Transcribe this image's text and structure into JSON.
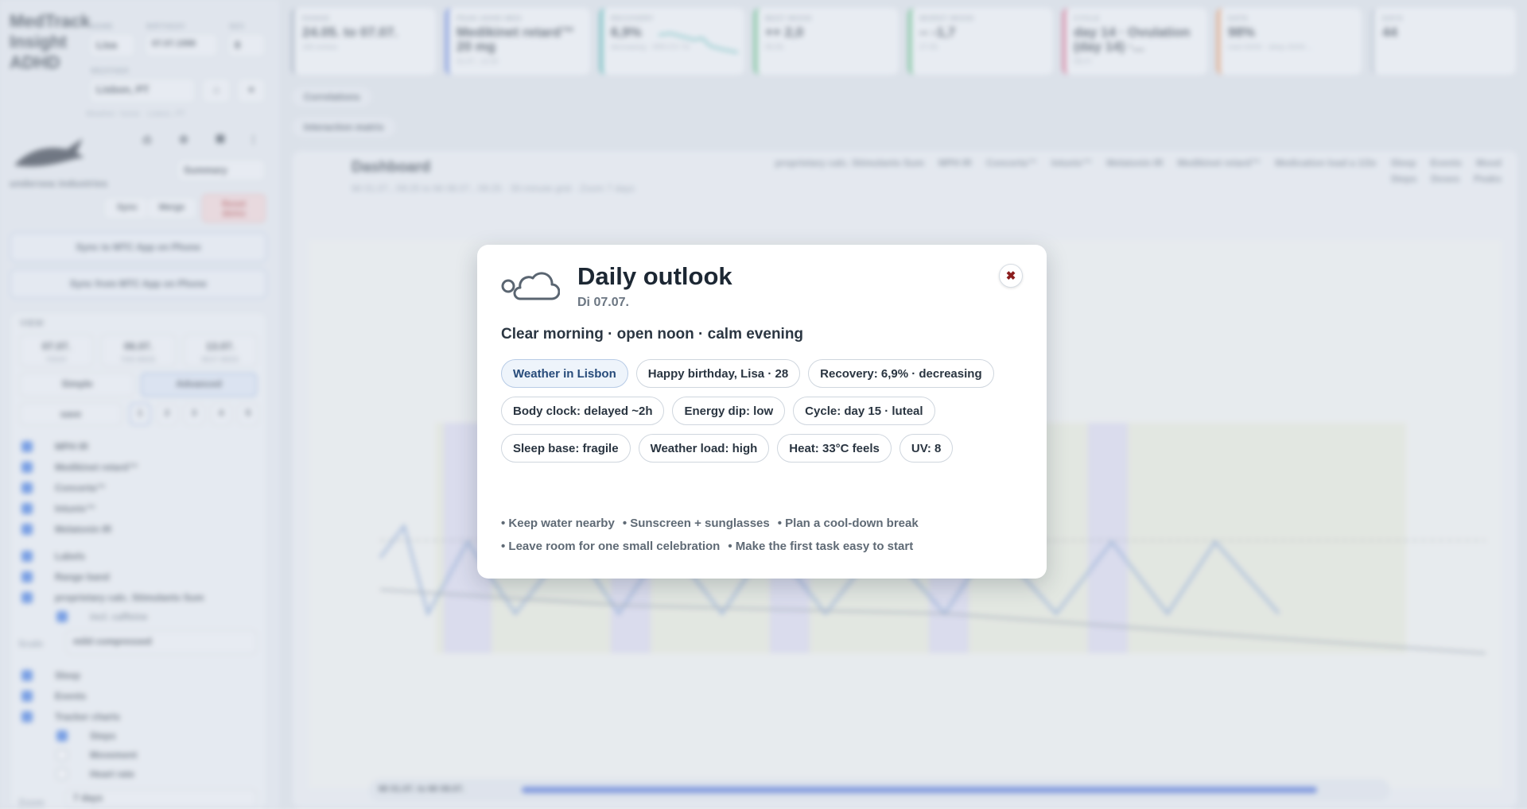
{
  "app": {
    "name_line1": "MedTrack",
    "name_line2": "Insight",
    "name_line3": "ADHD"
  },
  "sidebar": {
    "name_label": "NAME",
    "name_value": "Lisa",
    "birthday_label": "BIRTHDAY",
    "birthday_value": "07.07.1998",
    "sex_label": "SEX",
    "sex_value": "8",
    "weather_label": "WEATHER",
    "weather_value": "Lisbon, PT",
    "weather_note": "Weather: home · Lisbon, PT",
    "company": "undersea industries",
    "summary_label": "Summary",
    "sync_label": "Sync",
    "merge_label": "Merge",
    "reset_label": "Reset demo",
    "sync_to": "Sync to MTC App on Phone",
    "sync_from": "Sync from MTC App on Phone",
    "view_label": "VIEW",
    "dates": [
      {
        "value": "07.07.",
        "caption": "TODAY"
      },
      {
        "value": "06.07.",
        "caption": "THIS WEEK"
      },
      {
        "value": "13.07.",
        "caption": "NEXT WEEK"
      }
    ],
    "simple_label": "Simple",
    "advanced_label": "Advanced",
    "save_label": "save",
    "slots": [
      "1",
      "2",
      "3",
      "4",
      "5"
    ],
    "meds": [
      "MPH IR",
      "Medikinet retard™",
      "Concerta™",
      "Intuniv™",
      "Melatonin IR"
    ],
    "options": [
      "Labels",
      "Range band",
      "proprietary calc. Stimulants Sum"
    ],
    "incl_caffeine": "incl. caffeine",
    "scale_label": "Scale",
    "scale_value": "mild compressed",
    "toggles": [
      "Sleep",
      "Events",
      "Tracker charts"
    ],
    "trackers": [
      "Steps",
      "Movement",
      "Heart rate"
    ],
    "zoom_label": "Zoom",
    "zoom_value": "7 days"
  },
  "cards": [
    {
      "title": "RANGE",
      "value": "24.05. to 07.07.",
      "sub": "182 entries",
      "color": "#9aa7b5"
    },
    {
      "title": "PEAK ADHD MED",
      "value": "Medikinet retard™ 20 mg",
      "sub": "01.07., 12:30",
      "color": "#3c63d6"
    },
    {
      "title": "RECOVERY",
      "value": "6,9%",
      "sub": "decreasing · HRV-CV 7d",
      "color": "#23a6a0"
    },
    {
      "title": "BEST MOOD",
      "value": "++ 2,0",
      "sub": "06.06.",
      "color": "#2fae5c"
    },
    {
      "title": "WORST MOOD",
      "value": "-- -1,7",
      "sub": "27.05.",
      "color": "#2fae5c"
    },
    {
      "title": "CYCLE",
      "value": "day 14 · Ovulation (day 14) ·...",
      "sub": "08.07.",
      "color": "#d9436d"
    },
    {
      "title": "DATA",
      "value": "98%",
      "sub": "med 44/44 · sleep 43/44 ...",
      "color": "#e9803a"
    },
    {
      "title": "DAYS",
      "value": "44",
      "sub": "",
      "color": "#b8c2cc"
    }
  ],
  "collapsibles": [
    "Correlations",
    "Interaction matrix"
  ],
  "dashboard": {
    "title": "Dashboard",
    "subtitle": "Mi 01.07., 09:25 to Mi 08.07., 09:25 · 30-minute grid · Zoom 7 days",
    "legend": [
      "proprietary calc. Stimulants Sum",
      "MPH IR",
      "Concerta™",
      "Intuniv™",
      "Melatonin IR",
      "Medikinet retard™",
      "Medication load a 1/2e",
      "Sleep",
      "Events",
      "Mood",
      "Steps",
      "Doses",
      "Peaks"
    ],
    "range_label": "Mi 01.07. to Mi 08.07."
  },
  "modal": {
    "title": "Daily outlook",
    "date": "Di 07.07.",
    "headline": "Clear morning · open noon · calm evening",
    "chips": [
      "Weather in Lisbon",
      "Happy birthday, Lisa · 28",
      "Recovery: 6,9% · decreasing",
      "Body clock: delayed ~2h",
      "Energy dip: low",
      "Cycle: day 15 · luteal",
      "Sleep base: fragile",
      "Weather load: high",
      "Heat: 33°C feels",
      "UV: 8"
    ],
    "tips": [
      "• Keep water nearby",
      "• Sunscreen + sunglasses",
      "• Plan a cool-down break",
      "• Leave room for one small celebration",
      "• Make the first task easy to start"
    ]
  },
  "colors": {
    "accent": "#2f6ee0",
    "close_x": "#8b1d1d"
  }
}
